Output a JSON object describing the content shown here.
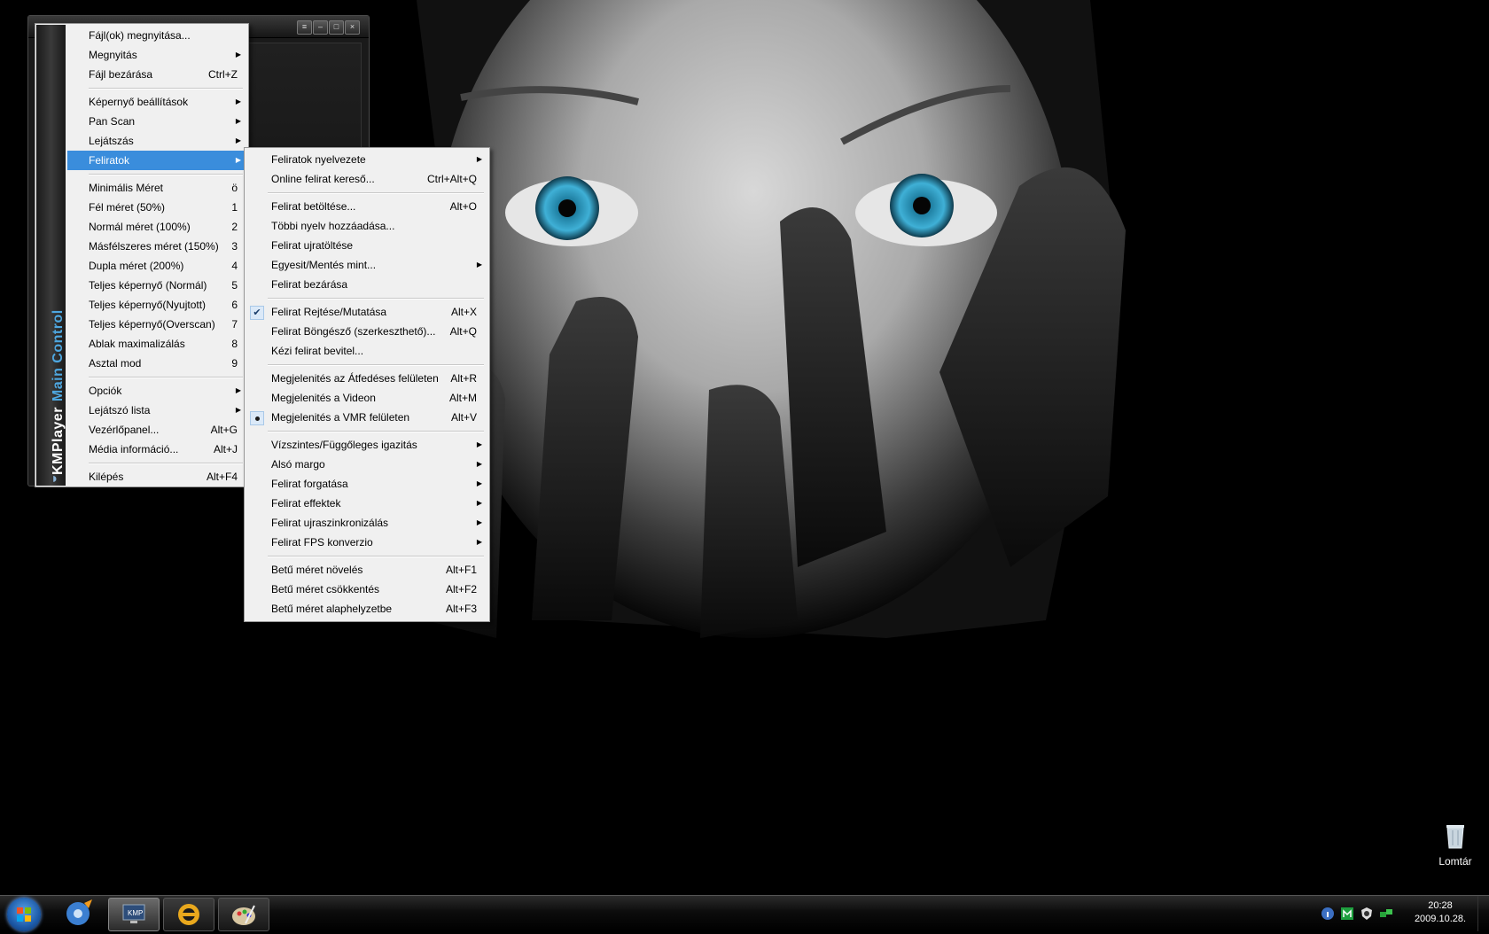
{
  "player": {
    "brand": "KMPlayer",
    "sub_title": "Main Control"
  },
  "main_menu": [
    {
      "label": "Fájl(ok) megnyitása...",
      "shortcut": "",
      "arrow": false
    },
    {
      "label": "Megnyitás",
      "shortcut": "",
      "arrow": true
    },
    {
      "label": "Fájl bezárása",
      "shortcut": "Ctrl+Z",
      "arrow": false
    },
    {
      "sep": true
    },
    {
      "label": "Képernyő beállítások",
      "shortcut": "",
      "arrow": true
    },
    {
      "label": "Pan  Scan",
      "shortcut": "",
      "arrow": true
    },
    {
      "label": "Lejátszás",
      "shortcut": "",
      "arrow": true
    },
    {
      "label": "Feliratok",
      "shortcut": "",
      "arrow": true,
      "highlighted": true
    },
    {
      "sep": true
    },
    {
      "label": "Minimális Méret",
      "shortcut": "ö",
      "arrow": false
    },
    {
      "label": "Fél méret (50%)",
      "shortcut": "1",
      "arrow": false
    },
    {
      "label": "Normál méret (100%)",
      "shortcut": "2",
      "arrow": false
    },
    {
      "label": "Másfélszeres méret (150%)",
      "shortcut": "3",
      "arrow": false
    },
    {
      "label": "Dupla méret (200%)",
      "shortcut": "4",
      "arrow": false
    },
    {
      "label": "Teljes képernyő (Normál)",
      "shortcut": "5",
      "arrow": false
    },
    {
      "label": "Teljes képernyő(Nyujtott)",
      "shortcut": "6",
      "arrow": false
    },
    {
      "label": "Teljes képernyő(Overscan)",
      "shortcut": "7",
      "arrow": false
    },
    {
      "label": "Ablak maximalizálás",
      "shortcut": "8",
      "arrow": false
    },
    {
      "label": "Asztal mod",
      "shortcut": "9",
      "arrow": false
    },
    {
      "sep": true
    },
    {
      "label": "Opciók",
      "shortcut": "",
      "arrow": true
    },
    {
      "label": "Lejátszó lista",
      "shortcut": "",
      "arrow": true
    },
    {
      "label": "Vezérlőpanel...",
      "shortcut": "Alt+G",
      "arrow": false
    },
    {
      "label": "Média információ...",
      "shortcut": "Alt+J",
      "arrow": false
    },
    {
      "sep": true
    },
    {
      "label": "Kilépés",
      "shortcut": "Alt+F4",
      "arrow": false
    }
  ],
  "sub_menu": [
    {
      "label": "Feliratok nyelvezete",
      "shortcut": "",
      "arrow": true
    },
    {
      "label": "Online felirat kereső...",
      "shortcut": "Ctrl+Alt+Q",
      "arrow": false
    },
    {
      "sep": true
    },
    {
      "label": "Felirat betöltése...",
      "shortcut": "Alt+O",
      "arrow": false
    },
    {
      "label": "Többi nyelv hozzáadása...",
      "shortcut": "",
      "arrow": false
    },
    {
      "label": "Felirat ujratöltése",
      "shortcut": "",
      "arrow": false
    },
    {
      "label": "Egyesit/Mentés mint...",
      "shortcut": "",
      "arrow": true
    },
    {
      "label": "Felirat bezárása",
      "shortcut": "",
      "arrow": false
    },
    {
      "sep": true
    },
    {
      "label": "Felirat Rejtése/Mutatása",
      "shortcut": "Alt+X",
      "arrow": false,
      "mark": "check"
    },
    {
      "label": "Felirat Böngésző (szerkeszthető)...",
      "shortcut": "Alt+Q",
      "arrow": false
    },
    {
      "label": "Kézi felirat bevitel...",
      "shortcut": "",
      "arrow": false
    },
    {
      "sep": true
    },
    {
      "label": "Megjelenités az Átfedéses felületen",
      "shortcut": "Alt+R",
      "arrow": false
    },
    {
      "label": "Megjelenités a Videon",
      "shortcut": "Alt+M",
      "arrow": false
    },
    {
      "label": "Megjelenités a VMR felületen",
      "shortcut": "Alt+V",
      "arrow": false,
      "mark": "radio"
    },
    {
      "sep": true
    },
    {
      "label": "Vízszintes/Függőleges igazitás",
      "shortcut": "",
      "arrow": true
    },
    {
      "label": "Alsó margo",
      "shortcut": "",
      "arrow": true
    },
    {
      "label": "Felirat forgatása",
      "shortcut": "",
      "arrow": true
    },
    {
      "label": "Felirat effektek",
      "shortcut": "",
      "arrow": true
    },
    {
      "label": "Felirat ujraszinkronizálás",
      "shortcut": "",
      "arrow": true
    },
    {
      "label": "Felirat FPS konverzio",
      "shortcut": "",
      "arrow": true
    },
    {
      "sep": true
    },
    {
      "label": "Betű méret növelés",
      "shortcut": "Alt+F1",
      "arrow": false
    },
    {
      "label": "Betű méret csökkentés",
      "shortcut": "Alt+F2",
      "arrow": false
    },
    {
      "label": "Betű méret alaphelyzetbe",
      "shortcut": "Alt+F3",
      "arrow": false
    }
  ],
  "desktop": {
    "recycle_bin_label": "Lomtár"
  },
  "taskbar": {
    "clock_time": "20:28",
    "clock_date": "2009.10.28."
  },
  "colors": {
    "menu_highlight": "#3a8ddc",
    "menu_bg": "#f0f0f0",
    "side_brand": "#ffffff",
    "side_sub": "#4ea7e0"
  }
}
